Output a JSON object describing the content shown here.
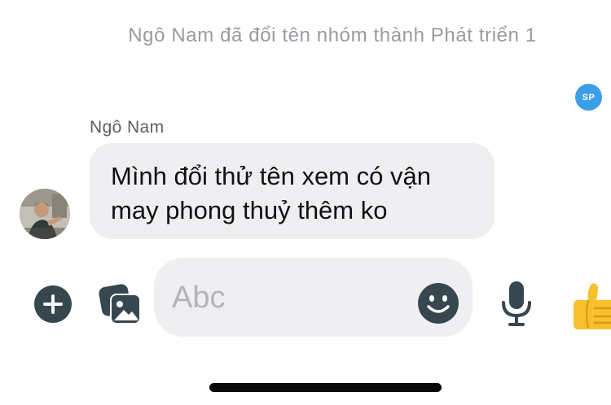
{
  "thread": {
    "system_message": "Ngô Nam đã đổi tên nhóm thành Phát triển 1",
    "seen_avatar_initials": "SP"
  },
  "message": {
    "sender": "Ngô Nam",
    "lines": [
      "Mình đổi thử tên xem có vận",
      "may phong thuỷ thêm ko"
    ]
  },
  "composer": {
    "placeholder": "Abc",
    "value": ""
  },
  "icons": {
    "add": "plus-icon",
    "gallery": "photo-gallery-icon",
    "emoji": "smiley-icon",
    "voice": "microphone-icon",
    "like": "thumbs-up-icon"
  },
  "colors": {
    "icon": "#37474f",
    "bubble": "#efeff1",
    "seen_avatar": "#3d9ee8",
    "system_text": "#9a9aa0"
  }
}
